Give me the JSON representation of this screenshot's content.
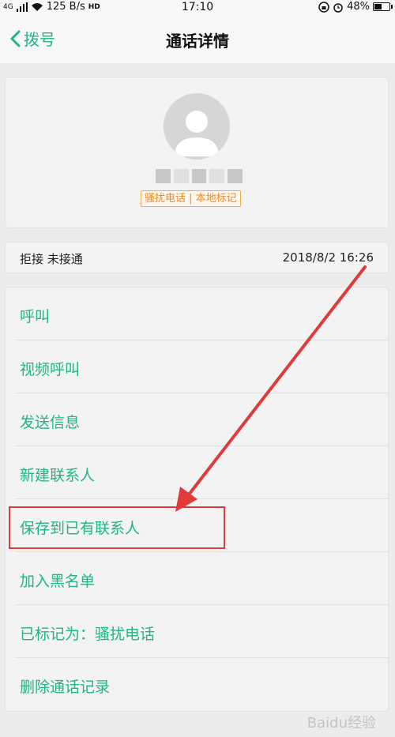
{
  "status_bar": {
    "network": "4G",
    "speed": "125 B/s",
    "volte": "HD",
    "time": "17:10",
    "battery": "48%",
    "battery_level": 0.48
  },
  "header": {
    "back_label": "拨号",
    "title": "通话详情"
  },
  "contact": {
    "tag": "骚扰电话 | 本地标记"
  },
  "record": {
    "status": "拒接 未接通",
    "datetime": "2018/8/2 16:26"
  },
  "actions": [
    {
      "label": "呼叫"
    },
    {
      "label": "视频呼叫"
    },
    {
      "label": "发送信息"
    },
    {
      "label": "新建联系人"
    },
    {
      "label": "保存到已有联系人"
    },
    {
      "label": "加入黑名单"
    },
    {
      "label": "已标记为：骚扰电话"
    },
    {
      "label": "删除通话记录"
    }
  ],
  "colors": {
    "accent": "#1fb584",
    "tag": "#f08a1e",
    "annotation": "#e03a3a"
  },
  "watermark": "Baidu经验"
}
